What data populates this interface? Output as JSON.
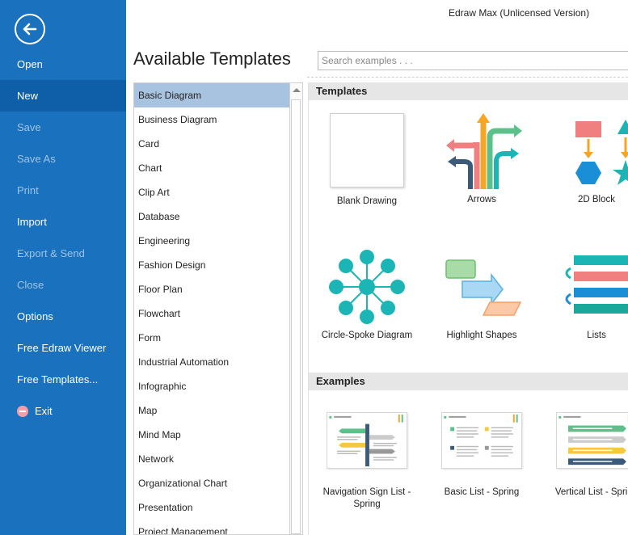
{
  "window": {
    "title": "Edraw Max (Unlicensed Version)"
  },
  "backstage": {
    "items": [
      {
        "label": "Open",
        "state": "normal"
      },
      {
        "label": "New",
        "state": "active"
      },
      {
        "label": "Save",
        "state": "disabled"
      },
      {
        "label": "Save As",
        "state": "disabled"
      },
      {
        "label": "Print",
        "state": "disabled"
      },
      {
        "label": "Import",
        "state": "normal"
      },
      {
        "label": "Export & Send",
        "state": "disabled"
      },
      {
        "label": "Close",
        "state": "disabled"
      },
      {
        "label": "Options",
        "state": "normal"
      },
      {
        "label": "Free Edraw Viewer",
        "state": "normal"
      },
      {
        "label": "Free Templates...",
        "state": "normal"
      },
      {
        "label": "Exit",
        "state": "normal",
        "icon": "exit-icon"
      }
    ],
    "back_icon": "back-arrow-icon"
  },
  "main": {
    "title": "Available Templates",
    "search": {
      "placeholder": "Search examples . . .",
      "value": ""
    },
    "categories": [
      "Basic Diagram",
      "Business Diagram",
      "Card",
      "Chart",
      "Clip Art",
      "Database",
      "Engineering",
      "Fashion Design",
      "Floor Plan",
      "Flowchart",
      "Form",
      "Industrial Automation",
      "Infographic",
      "Map",
      "Mind Map",
      "Network",
      "Organizational Chart",
      "Presentation",
      "Project Management"
    ],
    "selected_category": "Basic Diagram",
    "templates_header": "Templates",
    "templates": [
      {
        "label": "Blank Drawing",
        "icon": "blank-page-icon"
      },
      {
        "label": "Arrows",
        "icon": "arrows-icon"
      },
      {
        "label": "2D Block",
        "icon": "2d-block-icon"
      },
      {
        "label": "Circle-Spoke Diagram",
        "icon": "circle-spoke-icon"
      },
      {
        "label": "Highlight Shapes",
        "icon": "highlight-shapes-icon"
      },
      {
        "label": "Lists",
        "icon": "lists-icon"
      }
    ],
    "examples_header": "Examples",
    "examples": [
      {
        "label": "Navigation Sign List - Spring"
      },
      {
        "label": "Basic List - Spring"
      },
      {
        "label": "Vertical List - Spring"
      }
    ]
  },
  "colors": {
    "backstage_bg": "#1a72bf",
    "backstage_active": "#0f5ea8",
    "selected_category": "#a8c3e0",
    "teal": "#1cb5b5",
    "orange": "#f5a623",
    "salmon": "#f08080",
    "green": "#5cc08a",
    "navy": "#3b5a7a"
  }
}
